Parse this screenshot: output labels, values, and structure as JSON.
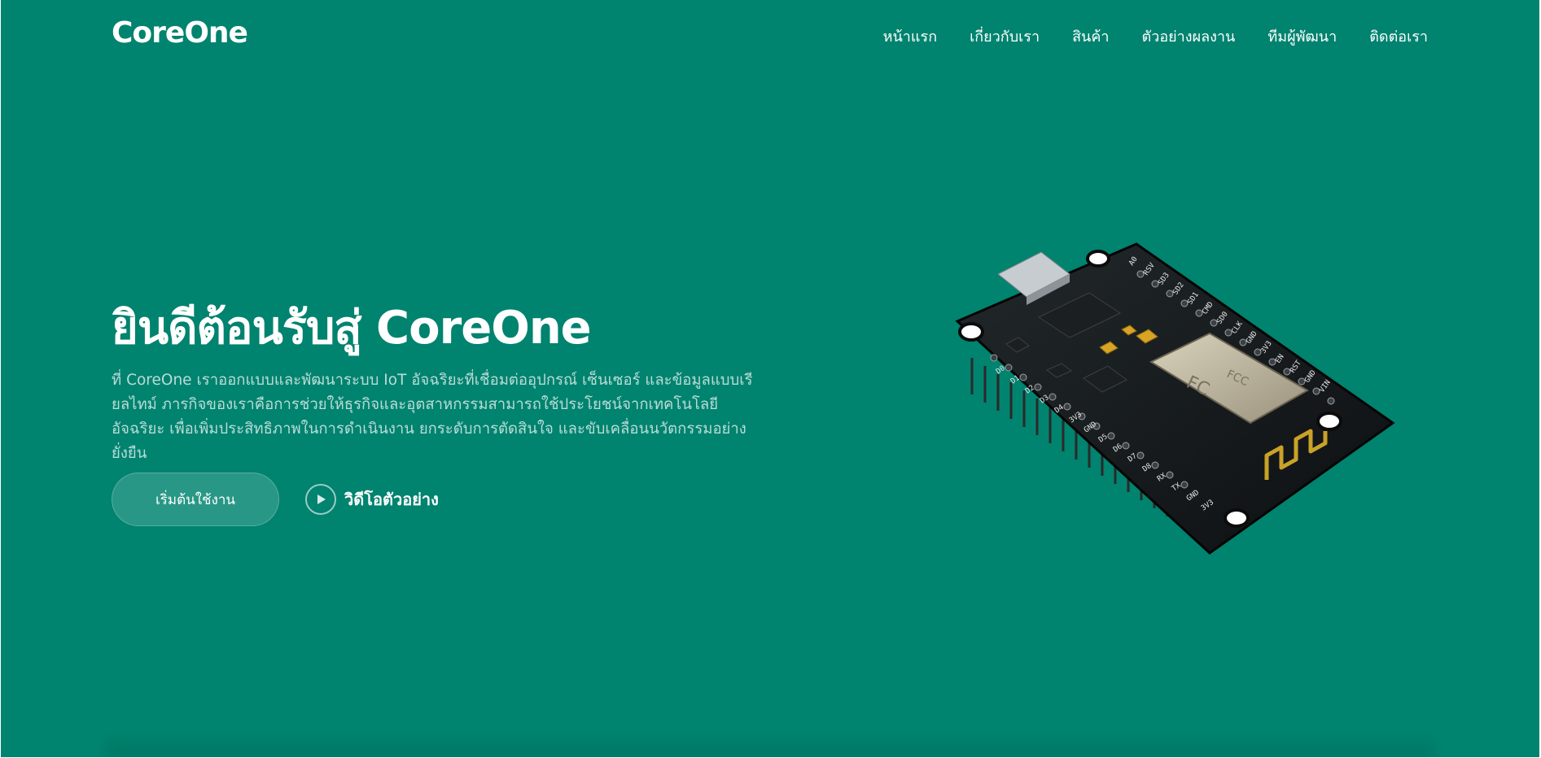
{
  "header": {
    "logo": "CoreOne",
    "nav": [
      {
        "label": "หน้าแรก"
      },
      {
        "label": "เกี่ยวกับเรา"
      },
      {
        "label": "สินค้า"
      },
      {
        "label": "ตัวอย่างผลงาน"
      },
      {
        "label": "ทีมผู้พัฒนา"
      },
      {
        "label": "ติดต่อเรา"
      }
    ]
  },
  "hero": {
    "title": "ยินดีต้อนรับสู่ CoreOne",
    "description": "ที่ CoreOne เราออกแบบและพัฒนาระบบ IoT อัจฉริยะที่เชื่อมต่ออุปกรณ์ เซ็นเซอร์ และข้อมูลแบบเรียลไทม์ ภารกิจของเราคือการช่วยให้ธุรกิจและอุตสาหกรรมสามารถใช้ประโยชน์จากเทคโนโลยีอัจฉริยะ เพื่อเพิ่มประสิทธิภาพในการดำเนินงาน ยกระดับการตัดสินใจ และขับเคลื่อนนวัตกรรมอย่างยั่งยืน",
    "start_button": "เริ่มต้นใช้งาน",
    "video_label": "วิดีโอตัวอย่าง"
  },
  "board_image": {
    "type": "nodemcu-esp8266-board",
    "module_labels": [
      "FC",
      "FCC"
    ],
    "pin_labels": [
      "A0",
      "RSV",
      "SD3",
      "SD2",
      "SD1",
      "CMD",
      "SD0",
      "CLK",
      "GND",
      "3V3",
      "EN",
      "RST",
      "GND",
      "VIN",
      "D0",
      "D1",
      "D2",
      "D3",
      "D4",
      "3V3",
      "GND",
      "D5",
      "D6",
      "D7",
      "D8",
      "RX",
      "TX",
      "GND",
      "3V3"
    ]
  },
  "colors": {
    "background": "#00836f",
    "text": "#ffffff",
    "board": "#15191b",
    "gold": "#c9a227"
  }
}
